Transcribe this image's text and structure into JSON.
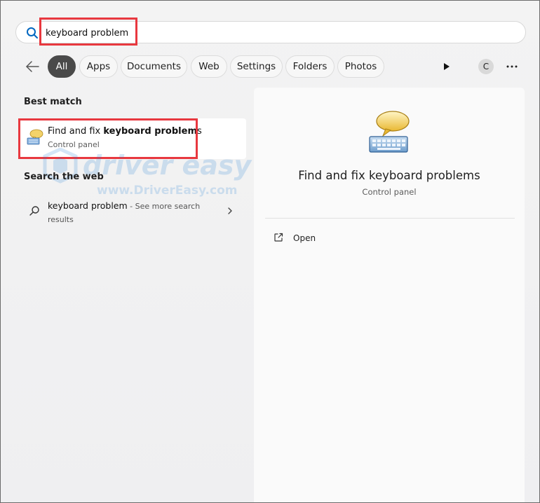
{
  "search": {
    "query": "keyboard problem",
    "icon": "search-icon",
    "accent": "#0067c0"
  },
  "filters": {
    "items": [
      {
        "label": "All",
        "active": true
      },
      {
        "label": "Apps",
        "active": false
      },
      {
        "label": "Documents",
        "active": false
      },
      {
        "label": "Web",
        "active": false
      },
      {
        "label": "Settings",
        "active": false
      },
      {
        "label": "Folders",
        "active": false
      },
      {
        "label": "Photos",
        "active": false
      }
    ],
    "avatar_letter": "C",
    "more_label": "···"
  },
  "best_match": {
    "heading": "Best match",
    "title_prefix": "Find and fix ",
    "title_bold": "keyboard problem",
    "title_suffix": "s",
    "subtitle": "Control panel",
    "icon": "keyboard-troubleshooter-icon"
  },
  "web": {
    "heading": "Search the web",
    "query": "keyboard problem",
    "separator": " - ",
    "see_more": "See more search",
    "results": "results"
  },
  "detail": {
    "title": "Find and fix keyboard problems",
    "subtitle": "Control panel",
    "open_label": "Open"
  },
  "watermark": {
    "brand": "driver easy",
    "url": "www.DriverEasy.com"
  },
  "colors": {
    "highlight": "#e8383f",
    "active_chip": "#4a4a4a"
  }
}
